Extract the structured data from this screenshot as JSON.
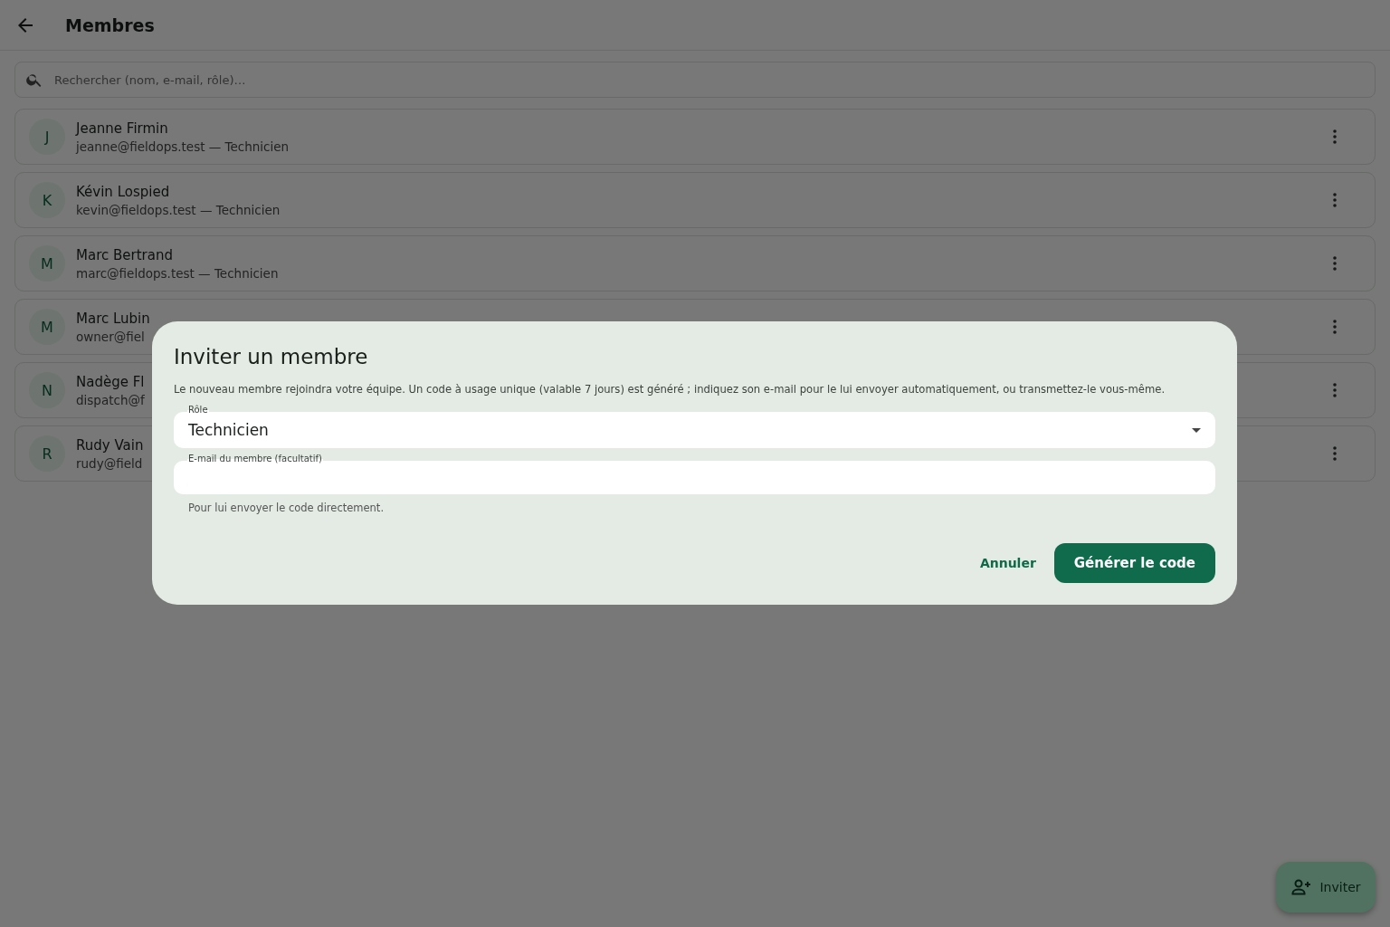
{
  "app_bar": {
    "title": "Membres"
  },
  "search": {
    "placeholder": "Rechercher (nom, e-mail, rôle)…"
  },
  "members": [
    {
      "initial": "J",
      "name": "Jeanne Firmin",
      "subtitle": "jeanne@fieldops.test — Technicien"
    },
    {
      "initial": "K",
      "name": "Kévin Lospied",
      "subtitle": "kevin@fieldops.test — Technicien"
    },
    {
      "initial": "M",
      "name": "Marc Bertrand",
      "subtitle": "marc@fieldops.test — Technicien"
    },
    {
      "initial": "M",
      "name": "Marc Lubin",
      "subtitle": "owner@fiel"
    },
    {
      "initial": "N",
      "name": "Nadège Fl",
      "subtitle": "dispatch@f"
    },
    {
      "initial": "R",
      "name": "Rudy Vain",
      "subtitle": "rudy@field"
    }
  ],
  "fab": {
    "label": "Inviter"
  },
  "dialog": {
    "title": "Inviter un membre",
    "text": "Le nouveau membre rejoindra votre équipe. Un code à usage unique (valable 7 jours) est généré ; indiquez son e-mail pour le lui envoyer automatiquement, ou transmettez-le vous-même.",
    "role_field": {
      "label": "Rôle",
      "value": "Technicien"
    },
    "email_field": {
      "label": "E-mail du membre (facultatif)",
      "helper": "Pour lui envoyer le code directement."
    },
    "buttons": [
      {
        "label": "Annuler",
        "kind": "text"
      },
      {
        "label": "Générer le code",
        "kind": "filled"
      }
    ]
  }
}
